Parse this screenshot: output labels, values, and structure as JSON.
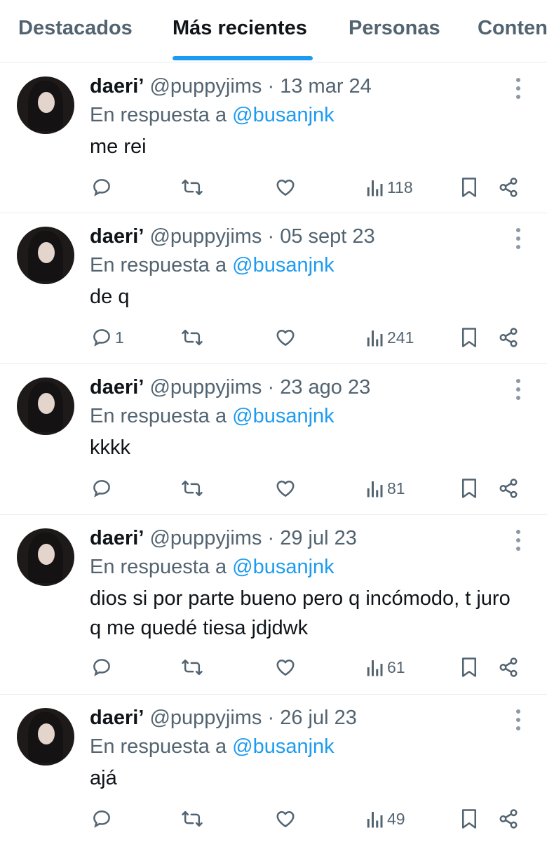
{
  "tabs": [
    {
      "label": "Destacados",
      "active": false
    },
    {
      "label": "Más recientes",
      "active": true
    },
    {
      "label": "Personas",
      "active": false
    },
    {
      "label": "Contenido",
      "active": false
    }
  ],
  "colors": {
    "accent": "#1d9bf0",
    "muted": "#536471",
    "text": "#0f1419",
    "divider": "#e6ecf0"
  },
  "icons": [
    "reply-icon",
    "retweet-icon",
    "like-icon",
    "views-icon",
    "bookmark-icon",
    "share-icon",
    "more-icon"
  ],
  "tweets": [
    {
      "name": "daeri’",
      "handle": "@puppyjims",
      "sep": "·",
      "date": "13 mar 24",
      "reply_prefix": "En respuesta a",
      "mention": "@busanjnk",
      "text": "me rei",
      "replies": "",
      "views": "118"
    },
    {
      "name": "daeri’",
      "handle": "@puppyjims",
      "sep": "·",
      "date": "05 sept 23",
      "reply_prefix": "En respuesta a",
      "mention": "@busanjnk",
      "text": "de q",
      "replies": "1",
      "views": "241"
    },
    {
      "name": "daeri’",
      "handle": "@puppyjims",
      "sep": "·",
      "date": "23 ago 23",
      "reply_prefix": "En respuesta a",
      "mention": "@busanjnk",
      "text": "kkkk",
      "replies": "",
      "views": "81"
    },
    {
      "name": "daeri’",
      "handle": "@puppyjims",
      "sep": "·",
      "date": "29 jul 23",
      "reply_prefix": "En respuesta a",
      "mention": "@busanjnk",
      "text": "dios si por parte bueno pero q incómodo, t juro q me quedé tiesa jdjdwk",
      "replies": "",
      "views": "61"
    },
    {
      "name": "daeri’",
      "handle": "@puppyjims",
      "sep": "·",
      "date": "26 jul 23",
      "reply_prefix": "En respuesta a",
      "mention": "@busanjnk",
      "text": "ajá",
      "replies": "",
      "views": "49"
    }
  ]
}
